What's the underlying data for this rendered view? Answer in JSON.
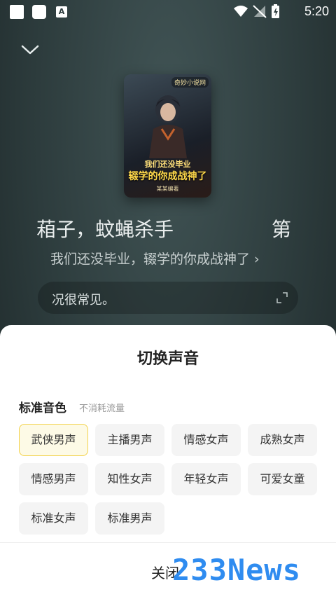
{
  "status_bar": {
    "time": "5:20",
    "launcher_icon_letter": "A"
  },
  "player": {
    "collapse_icon": "chevron-down-icon",
    "cover": {
      "tag": "奇妙小说网",
      "title_line1": "我们还没毕业",
      "title_line2": "辍学的你成战神了",
      "author": "某某编著"
    },
    "chapter_title_left": "葙子，蚊蝇杀手",
    "chapter_title_right": "第",
    "book_title": "我们还没毕业，辍学的你成战神了",
    "book_arrow": "›",
    "subtitle_text": "况很常见。",
    "expand_icon": "expand-icon"
  },
  "voice_sheet": {
    "title": "切换声音",
    "section_title": "标准音色",
    "section_note": "不消耗流量",
    "voices": [
      "武侠男声",
      "主播男声",
      "情感女声",
      "成熟女声",
      "情感男声",
      "知性女声",
      "年轻女声",
      "可爱女童",
      "标准女声",
      "标准男声"
    ],
    "selected_index": 0,
    "close_label": "关闭"
  },
  "watermark": "233News",
  "colors": {
    "accent_border": "#f3d24a",
    "accent_fill": "#fdfae6",
    "watermark": "#2f8cf0"
  }
}
